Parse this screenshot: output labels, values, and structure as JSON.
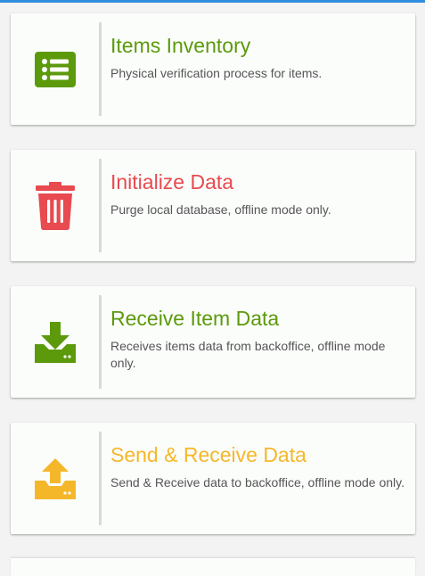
{
  "colors": {
    "green": "#5c9a0c",
    "red": "#e84a4f",
    "yellow": "#f5b72a",
    "text_muted": "#555555",
    "top_bar": "#2f8ee0"
  },
  "menu": {
    "items": [
      {
        "title": "Items Inventory",
        "description": "Physical verification process for items.",
        "icon": "list-icon",
        "color": "#5c9a0c"
      },
      {
        "title": "Initialize Data",
        "description": "Purge local database, offline mode only.",
        "icon": "trash-icon",
        "color": "#e84a4f"
      },
      {
        "title": "Receive Item Data",
        "description": "Receives items data from backoffice, offline mode only.",
        "icon": "download-icon",
        "color": "#5c9a0c"
      },
      {
        "title": "Send & Receive Data",
        "description": "Send & Receive data to backoffice, offline mode only.",
        "icon": "upload-icon",
        "color": "#f5b72a"
      }
    ]
  }
}
